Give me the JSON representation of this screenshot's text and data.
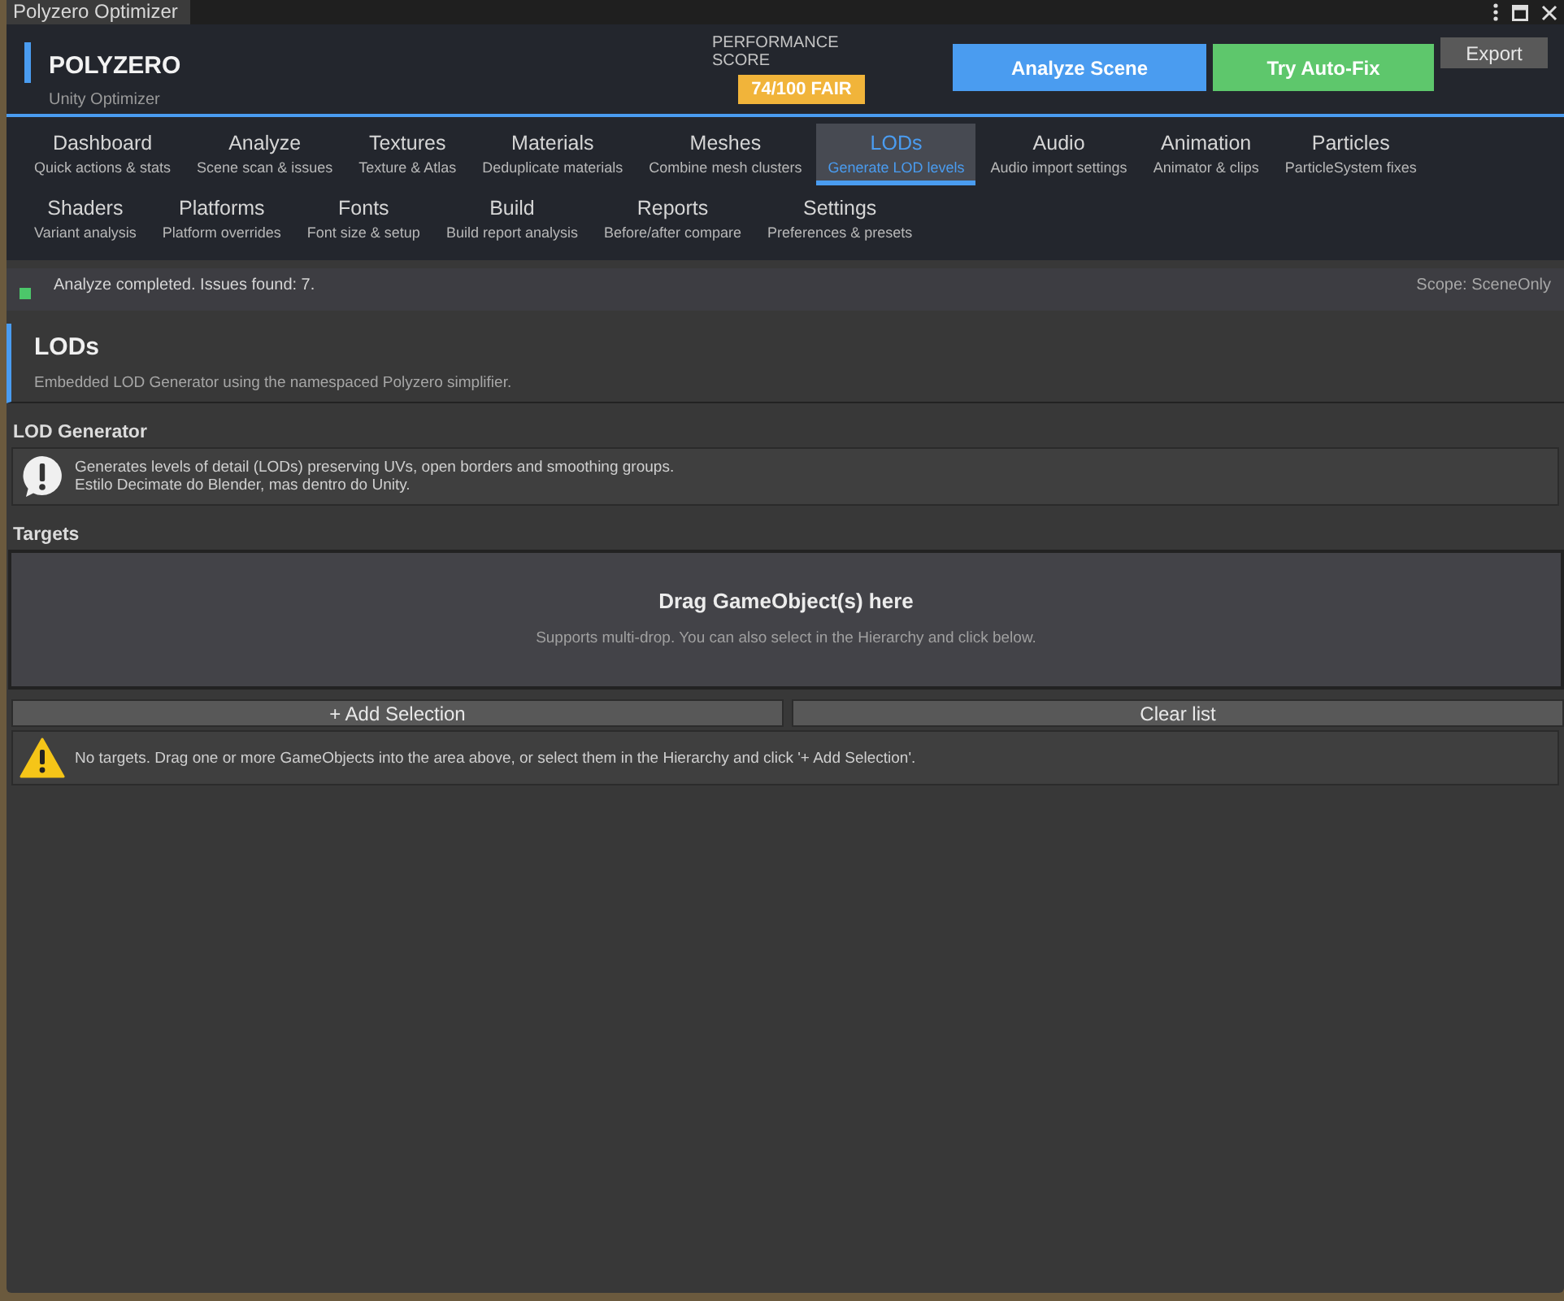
{
  "window": {
    "title": "Polyzero Optimizer"
  },
  "header": {
    "brand": "POLYZERO",
    "subtitle": "Unity Optimizer",
    "score_label": "PERFORMANCE SCORE",
    "score": "74/100 FAIR",
    "buttons": [
      {
        "label": "Analyze Scene",
        "kind": "primary"
      },
      {
        "label": "Try Auto-Fix",
        "kind": "success"
      },
      {
        "label": "Export",
        "kind": "secondary"
      }
    ]
  },
  "tabs": [
    {
      "title": "Dashboard",
      "subtitle": "Quick actions & stats",
      "selected": false
    },
    {
      "title": "Analyze",
      "subtitle": "Scene scan & issues",
      "selected": false
    },
    {
      "title": "Textures",
      "subtitle": "Texture & Atlas",
      "selected": false
    },
    {
      "title": "Materials",
      "subtitle": "Deduplicate materials",
      "selected": false
    },
    {
      "title": "Meshes",
      "subtitle": "Combine mesh clusters",
      "selected": false
    },
    {
      "title": "LODs",
      "subtitle": "Generate LOD levels",
      "selected": true
    },
    {
      "title": "Audio",
      "subtitle": "Audio import settings",
      "selected": false
    },
    {
      "title": "Animation",
      "subtitle": "Animator & clips",
      "selected": false
    },
    {
      "title": "Particles",
      "subtitle": "ParticleSystem fixes",
      "selected": false
    },
    {
      "title": "Shaders",
      "subtitle": "Variant analysis",
      "selected": false
    },
    {
      "title": "Platforms",
      "subtitle": "Platform overrides",
      "selected": false
    },
    {
      "title": "Fonts",
      "subtitle": "Font size & setup",
      "selected": false
    },
    {
      "title": "Build",
      "subtitle": "Build report analysis",
      "selected": false
    },
    {
      "title": "Reports",
      "subtitle": "Before/after compare",
      "selected": false
    },
    {
      "title": "Settings",
      "subtitle": "Preferences & presets",
      "selected": false
    }
  ],
  "status_bar": {
    "kind": "success",
    "message": "Analyze completed. Issues found: 7.",
    "scope": "Scope: SceneOnly"
  },
  "page": {
    "title": "LODs",
    "description": "Embedded LOD Generator using the namespaced Polyzero simplifier."
  },
  "sections": [
    {
      "heading": "LOD Generator",
      "callout": {
        "kind": "info",
        "lines": [
          "Generates levels of detail (LODs) preserving UVs, open borders and smoothing groups.",
          "Estilo Decimate do Blender, mas dentro do Unity."
        ]
      }
    },
    {
      "heading": "Targets",
      "drop_zone": {
        "title": "Drag GameObject(s) here",
        "hint": "Supports multi-drop. You can also select in the Hierarchy and click below."
      },
      "buttons": [
        "+ Add Selection",
        "Clear list"
      ],
      "callout": {
        "kind": "warning",
        "lines": [
          "No targets. Drag one or more GameObjects into the area above, or select them in the Hierarchy and click '+ Add Selection'."
        ]
      }
    }
  ]
}
